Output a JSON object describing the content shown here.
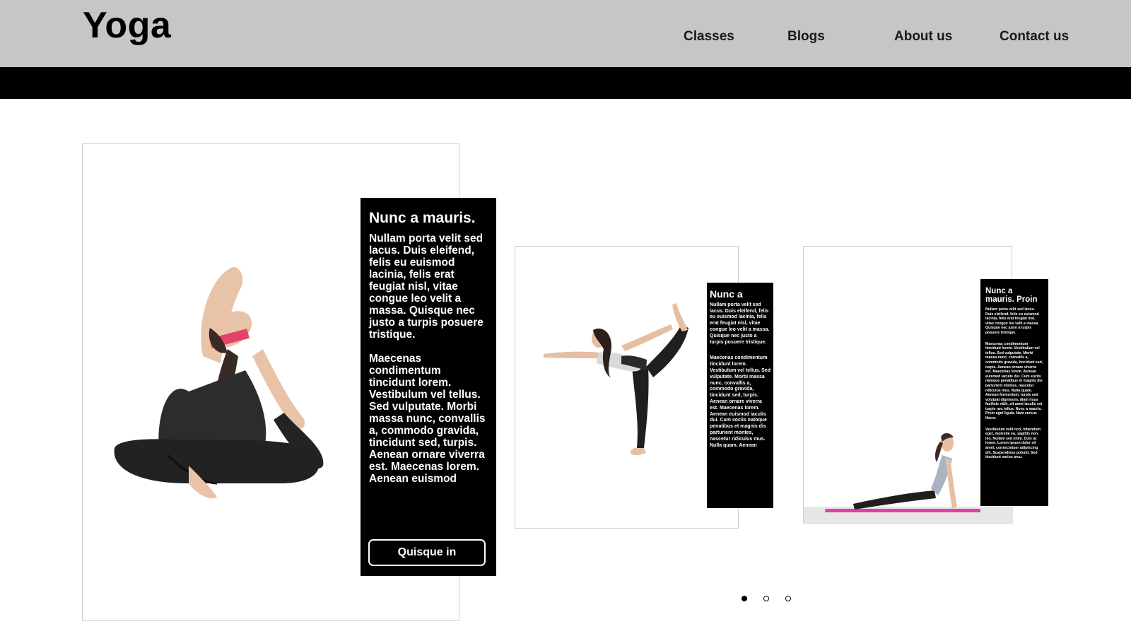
{
  "header": {
    "logo": "Yoga",
    "nav": [
      {
        "label": "Classes"
      },
      {
        "label": "Blogs"
      },
      {
        "label": "About us"
      },
      {
        "label": "Contact us"
      }
    ]
  },
  "colors": {
    "header_bg": "#c6c6c8",
    "bar": "#000000",
    "panel_bg": "#000000",
    "panel_text": "#ffffff"
  },
  "cards": [
    {
      "title": "Nunc a mauris.",
      "para1": "Nullam porta velit sed lacus. Duis eleifend, felis eu euismod lacinia, felis erat feugiat nisl, vitae congue leo velit a massa. Quisque nec justo a turpis posuere tristique.",
      "para2": "Maecenas condimentum tincidunt lorem. Vestibulum vel tellus. Sed vulputate. Morbi massa nunc, convallis a, commodo gravida, tincidunt sed, turpis. Aenean ornare viverra est. Maecenas lorem. Aenean euismod",
      "button": "Quisque in",
      "image_alt": "woman in king pigeon pose"
    },
    {
      "title": "Nunc a",
      "para1": "Nullam porta velit sed lacus. Duis eleifend, felis eu euismod lacinia, felis erat feugiat nisl, vitae congue leo velit a massa. Quisque nec justo a turpis posuere tristique.",
      "para2": "Maecenas condimentum tincidunt lorem. Vestibulum vel tellus. Sed vulputate. Morbi massa nunc, convallis a, commodo gravida, tincidunt sed, turpis. Aenean ornare viverra est. Maecenas lorem. Aenean euismod iaculis dui. Cum sociis natoque penatibus et magnis dis parturient montes, nascetur ridiculus mus. Nulla quam. Aenean",
      "image_alt": "woman in dancer pose"
    },
    {
      "title": "Nunc a mauris. Proin",
      "para1": "Nullam porta velit sed lacus. Duis eleifend, felis eu euismod lacinia, felis erat feugiat nisl, vitae congue leo velit a massa. Quisque nec justo a turpis posuere tristique.",
      "para2": "Maecenas condimentum tincidunt lorem. Vestibulum vel tellus. Sed vulputate. Morbi massa nunc, convallis a, commodo gravida, tincidunt sed, turpis. Aenean ornare viverra est. Maecenas lorem. Aenean euismod iaculis dui. Cum sociis natoque penatibus et magnis dis parturient montes, nascetur ridiculus mus. Nulla quam. Aenean fermentum, turpis sed volutpat dignissim, diam risus facilisis nibh, sit amet iaculis est turpis nec tellus. Nunc a mauris. Proin eget ligula. Nam cursus libero.",
      "para3": "Vestibulum velit orci, bibendum eget, molestie eu, sagittis non, leo. Nullam sed enim. Duis ac lorem. Lorem ipsum dolor sit amet, consectetuer adipiscing elit. Suspendisse potenti. Sed tincidunt varius arcu.",
      "image_alt": "woman in upward dog pose on mat"
    }
  ],
  "carousel": {
    "active_index": 0,
    "count": 3
  }
}
